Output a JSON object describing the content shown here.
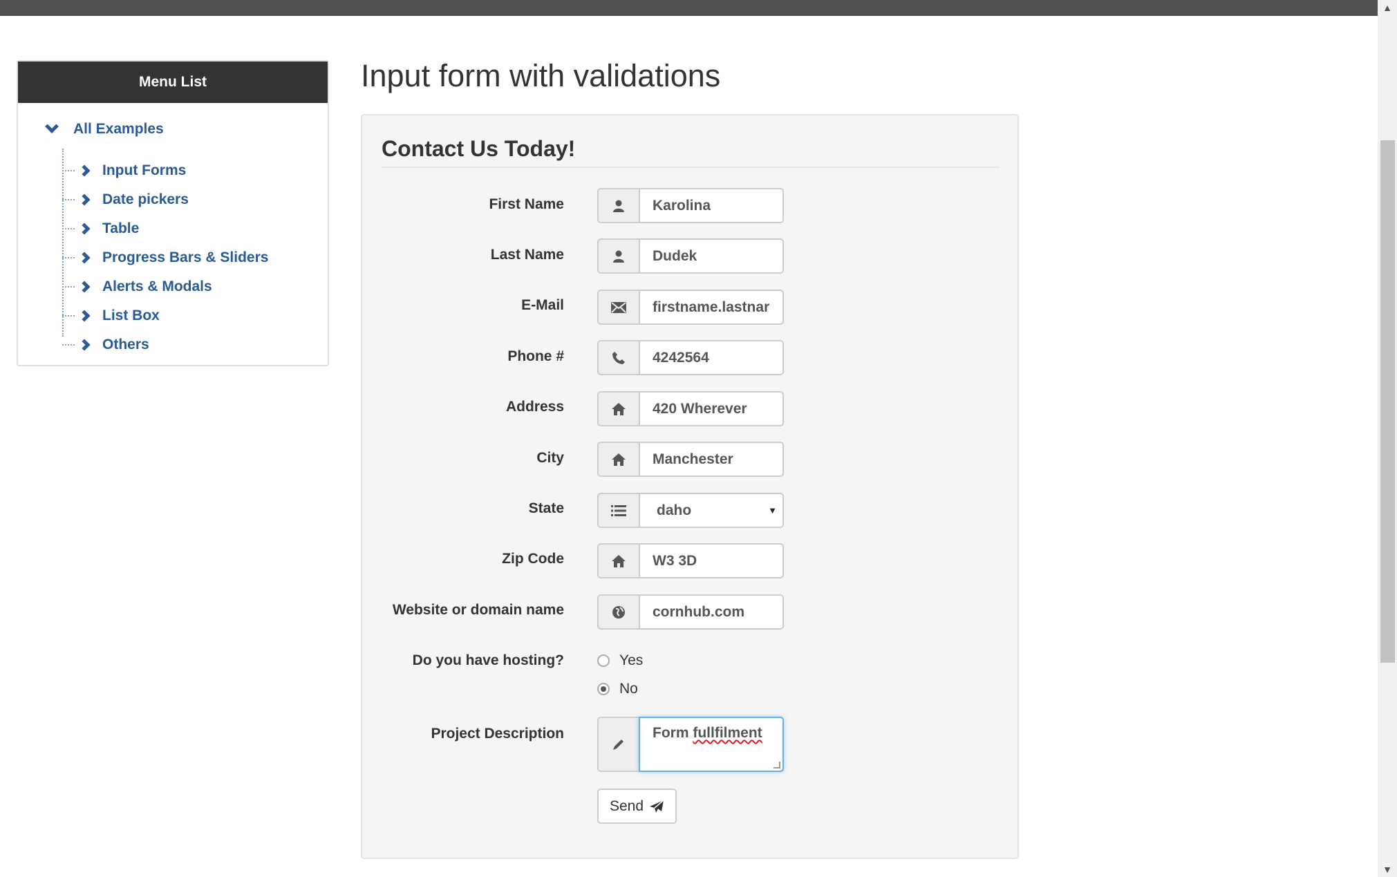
{
  "sidebar": {
    "header": "Menu List",
    "root": "All Examples",
    "items": [
      {
        "label": "Input Forms"
      },
      {
        "label": "Date pickers"
      },
      {
        "label": "Table"
      },
      {
        "label": "Progress Bars & Sliders"
      },
      {
        "label": "Alerts & Modals"
      },
      {
        "label": "List Box"
      },
      {
        "label": "Others"
      }
    ]
  },
  "page": {
    "title": "Input form with validations"
  },
  "form": {
    "legend": "Contact Us Today!",
    "fields": {
      "first_name": {
        "label": "First Name",
        "value": "Karolina",
        "icon": "user-icon"
      },
      "last_name": {
        "label": "Last Name",
        "value": "Dudek",
        "icon": "user-icon"
      },
      "email": {
        "label": "E-Mail",
        "value": "firstname.lastnar",
        "icon": "envelope-icon"
      },
      "phone": {
        "label": "Phone #",
        "value": "4242564",
        "icon": "phone-icon"
      },
      "address": {
        "label": "Address",
        "value": "420 Wherever",
        "icon": "home-icon"
      },
      "city": {
        "label": "City",
        "value": "Manchester",
        "icon": "home-icon"
      },
      "state": {
        "label": "State",
        "value": "daho",
        "icon": "list-icon"
      },
      "zip": {
        "label": "Zip Code",
        "value": "W3 3D",
        "icon": "home-icon"
      },
      "website": {
        "label": "Website or domain name",
        "value": "cornhub.com",
        "icon": "globe-icon"
      }
    },
    "hosting": {
      "label": "Do you have hosting?",
      "options": [
        "Yes",
        "No"
      ],
      "selected": "No"
    },
    "description": {
      "label": "Project Description",
      "value_plain": "Form ",
      "value_misspelled": "fullfilment",
      "icon": "pencil-icon"
    },
    "send_label": "Send"
  },
  "colors": {
    "menu_header_bg": "#333333",
    "link": "#2a5a96",
    "panel_bg": "#f5f5f5",
    "focus_border": "#66afe9"
  }
}
